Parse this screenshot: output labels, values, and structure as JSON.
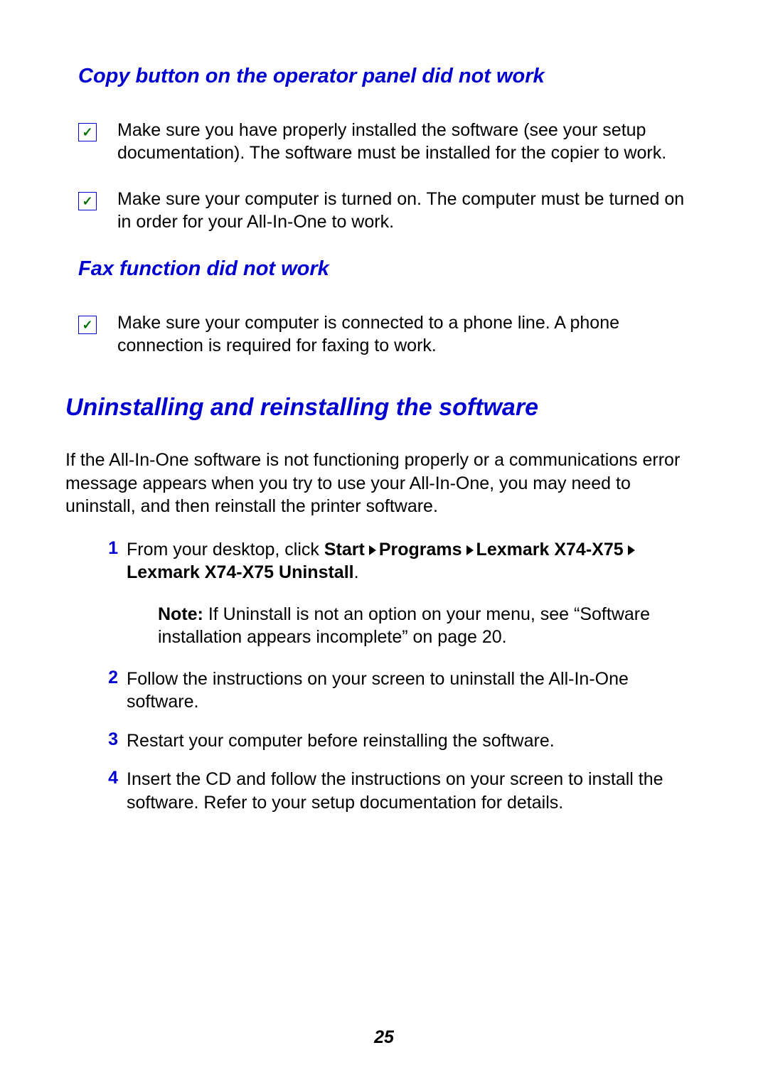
{
  "headings": {
    "h1": "Copy button on the operator panel did not work",
    "h2": "Fax function did not work",
    "h3": "Uninstalling and reinstalling the software"
  },
  "checks": {
    "c1": "Make sure you have properly installed the software (see your setup documentation). The software must be installed for the copier to work.",
    "c2": "Make sure your computer is turned on. The computer must be turned on in order for your All-In-One to work.",
    "c3": "Make sure your computer is connected to a phone line. A phone connection is required for faxing to work."
  },
  "intro": "If the All-In-One software is not functioning properly or a communications error message appears when you try to use your All-In-One, you may need to uninstall, and then reinstall the printer software.",
  "steps": {
    "n1": "1",
    "s1_pre": "From your desktop, click ",
    "s1_b1": "Start",
    "s1_b2": "Programs",
    "s1_b3": "Lexmark X74-X75",
    "s1_b4": "Lexmark X74-X75 Uninstall",
    "s1_end": ".",
    "note_label": "Note:",
    "note_body": " If Uninstall is not an option on your menu, see “Software installation appears incomplete” on page 20.",
    "n2": "2",
    "s2": "Follow the instructions on your screen to uninstall the All-In-One software.",
    "n3": "3",
    "s3": "Restart your computer before reinstalling the software.",
    "n4": "4",
    "s4": "Insert the CD and follow the instructions on your screen to install the software. Refer to your setup documentation for details."
  },
  "page": "25"
}
